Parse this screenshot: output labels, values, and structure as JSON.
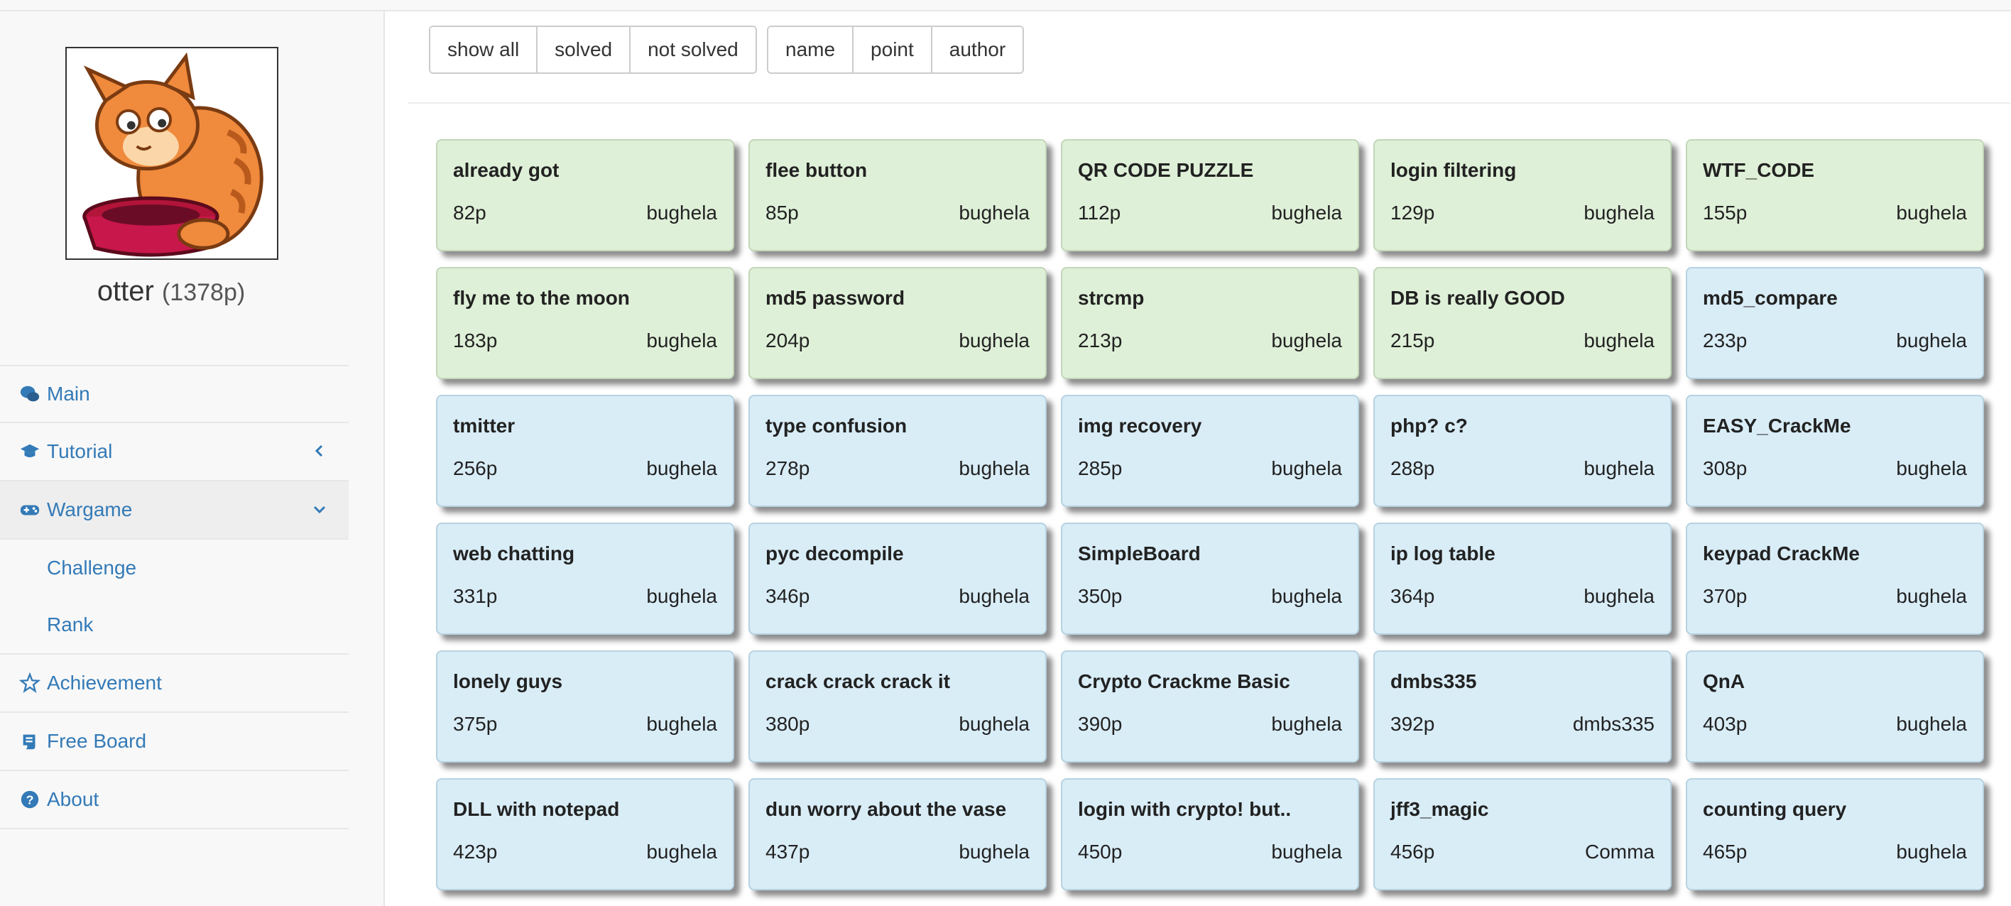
{
  "user": {
    "name": "otter",
    "points": "(1378p)"
  },
  "nav": {
    "main": "Main",
    "tutorial": "Tutorial",
    "wargame": "Wargame",
    "challenge": "Challenge",
    "rank": "Rank",
    "achievement": "Achievement",
    "freeboard": "Free Board",
    "about": "About"
  },
  "filters": {
    "show_all": "show all",
    "solved": "solved",
    "not_solved": "not solved"
  },
  "sorts": {
    "name": "name",
    "point": "point",
    "author": "author"
  },
  "colors": {
    "solved": "#dff0d8",
    "unsolved": "#d9edf7",
    "link": "#337ab7"
  },
  "challenges": [
    {
      "title": "already got",
      "points": "82p",
      "author": "bughela",
      "status": "solved"
    },
    {
      "title": "flee button",
      "points": "85p",
      "author": "bughela",
      "status": "solved"
    },
    {
      "title": "QR CODE PUZZLE",
      "points": "112p",
      "author": "bughela",
      "status": "solved"
    },
    {
      "title": "login filtering",
      "points": "129p",
      "author": "bughela",
      "status": "solved"
    },
    {
      "title": "WTF_CODE",
      "points": "155p",
      "author": "bughela",
      "status": "solved"
    },
    {
      "title": "fly me to the moon",
      "points": "183p",
      "author": "bughela",
      "status": "solved"
    },
    {
      "title": "md5 password",
      "points": "204p",
      "author": "bughela",
      "status": "solved"
    },
    {
      "title": "strcmp",
      "points": "213p",
      "author": "bughela",
      "status": "solved"
    },
    {
      "title": "DB is really GOOD",
      "points": "215p",
      "author": "bughela",
      "status": "solved"
    },
    {
      "title": "md5_compare",
      "points": "233p",
      "author": "bughela",
      "status": "unsolved"
    },
    {
      "title": "tmitter",
      "points": "256p",
      "author": "bughela",
      "status": "unsolved"
    },
    {
      "title": "type confusion",
      "points": "278p",
      "author": "bughela",
      "status": "unsolved"
    },
    {
      "title": "img recovery",
      "points": "285p",
      "author": "bughela",
      "status": "unsolved"
    },
    {
      "title": "php? c?",
      "points": "288p",
      "author": "bughela",
      "status": "unsolved"
    },
    {
      "title": "EASY_CrackMe",
      "points": "308p",
      "author": "bughela",
      "status": "unsolved"
    },
    {
      "title": "web chatting",
      "points": "331p",
      "author": "bughela",
      "status": "unsolved"
    },
    {
      "title": "pyc decompile",
      "points": "346p",
      "author": "bughela",
      "status": "unsolved"
    },
    {
      "title": "SimpleBoard",
      "points": "350p",
      "author": "bughela",
      "status": "unsolved"
    },
    {
      "title": "ip log table",
      "points": "364p",
      "author": "bughela",
      "status": "unsolved"
    },
    {
      "title": "keypad CrackMe",
      "points": "370p",
      "author": "bughela",
      "status": "unsolved"
    },
    {
      "title": "lonely guys",
      "points": "375p",
      "author": "bughela",
      "status": "unsolved"
    },
    {
      "title": "crack crack crack it",
      "points": "380p",
      "author": "bughela",
      "status": "unsolved"
    },
    {
      "title": "Crypto Crackme Basic",
      "points": "390p",
      "author": "bughela",
      "status": "unsolved"
    },
    {
      "title": "dmbs335",
      "points": "392p",
      "author": "dmbs335",
      "status": "unsolved"
    },
    {
      "title": "QnA",
      "points": "403p",
      "author": "bughela",
      "status": "unsolved"
    },
    {
      "title": "DLL with notepad",
      "points": "423p",
      "author": "bughela",
      "status": "unsolved"
    },
    {
      "title": "dun worry about the vase",
      "points": "437p",
      "author": "bughela",
      "status": "unsolved"
    },
    {
      "title": "login with crypto! but..",
      "points": "450p",
      "author": "bughela",
      "status": "unsolved"
    },
    {
      "title": "jff3_magic",
      "points": "456p",
      "author": "Comma",
      "status": "unsolved"
    },
    {
      "title": "counting query",
      "points": "465p",
      "author": "bughela",
      "status": "unsolved"
    }
  ]
}
